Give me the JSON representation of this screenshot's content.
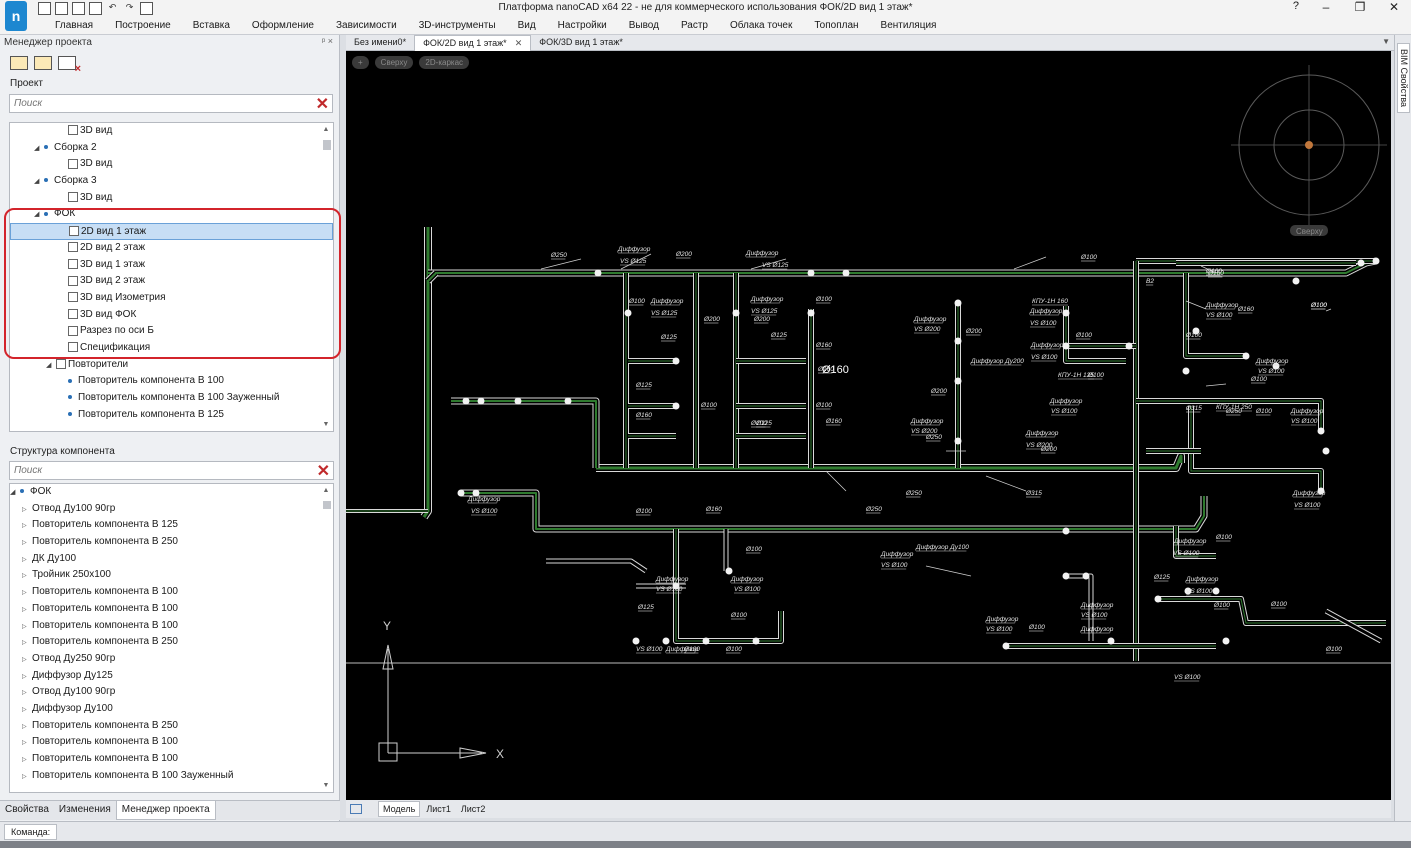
{
  "window": {
    "title": "Платформа nanoCAD x64 22 - не для коммерческого использования ФОК/2D вид 1 этаж*",
    "logo": "n",
    "controls": [
      "–",
      "❐",
      "✕"
    ],
    "help": "?"
  },
  "menu": [
    "Главная",
    "Построение",
    "Вставка",
    "Оформление",
    "Зависимости",
    "3D-инструменты",
    "Вид",
    "Настройки",
    "Вывод",
    "Растр",
    "Облака точек",
    "Топоплан",
    "Вентиляция"
  ],
  "left_panel": {
    "header": "Менеджер проекта",
    "project_label": "Проект",
    "search_placeholder": "Поиск",
    "project_tree": [
      {
        "label": "3D вид",
        "indent": 4,
        "icon": "view"
      },
      {
        "label": "Сборка 2",
        "indent": 2,
        "icon": "node"
      },
      {
        "label": "3D вид",
        "indent": 4,
        "icon": "view"
      },
      {
        "label": "Сборка 3",
        "indent": 2,
        "icon": "node"
      },
      {
        "label": "3D вид",
        "indent": 4,
        "icon": "view"
      },
      {
        "label": "ФОК",
        "indent": 2,
        "icon": "node"
      },
      {
        "label": "2D вид 1 этаж",
        "indent": 4,
        "icon": "view",
        "selected": true
      },
      {
        "label": "2D вид 2 этаж",
        "indent": 4,
        "icon": "view"
      },
      {
        "label": "3D вид 1 этаж",
        "indent": 4,
        "icon": "view"
      },
      {
        "label": "3D вид 2 этаж",
        "indent": 4,
        "icon": "view"
      },
      {
        "label": "3D вид Изометрия",
        "indent": 4,
        "icon": "view"
      },
      {
        "label": "3D вид ФОК",
        "indent": 4,
        "icon": "view"
      },
      {
        "label": "Разрез по оси Б",
        "indent": 4,
        "icon": "view"
      },
      {
        "label": "Спецификация",
        "indent": 4,
        "icon": "table"
      },
      {
        "label": "Повторители",
        "indent": 3,
        "icon": "folder"
      },
      {
        "label": "Повторитель компонента В 100",
        "indent": 4,
        "icon": "dot"
      },
      {
        "label": "Повторитель компонента В 100 Зауженный",
        "indent": 4,
        "icon": "dot"
      },
      {
        "label": "Повторитель компонента В 125",
        "indent": 4,
        "icon": "dot"
      }
    ],
    "structure_label": "Структура компонента",
    "structure_search_placeholder": "Поиск",
    "structure_root": "ФОК",
    "structure_items": [
      "Отвод Ду100 90гр",
      "Повторитель компонента В 125",
      "Повторитель компонента В 250",
      "ДК Ду100",
      "Тройник 250х100",
      "Повторитель компонента В 100",
      "Повторитель компонента В 100",
      "Повторитель компонента В 100",
      "Повторитель компонента В 250",
      "Отвод Ду250 90гр",
      "Диффузор Ду125",
      "Отвод Ду100 90гр",
      "Диффузор Ду100",
      "Повторитель компонента В 250",
      "Повторитель компонента В 100",
      "Повторитель компонента В 100",
      "Повторитель компонента В 100 Зауженный"
    ],
    "bottom_tabs": [
      "Свойства",
      "Изменения",
      "Менеджер проекта"
    ]
  },
  "doc_tabs": [
    "Без имени0*",
    "ФОК/2D вид 1 этаж*",
    "ФОК/3D вид 1 этаж*"
  ],
  "view_controls": [
    "+",
    "Сверху",
    "2D-каркас"
  ],
  "viewcube_label": "Сверху",
  "model_tabs": [
    "Модель",
    "Лист1",
    "Лист2"
  ],
  "right_strip": "BIM Свойства",
  "command_label": "Команда:",
  "drawing_labels": [
    "Ø250",
    "Диффузор",
    "VS Ø125",
    "Ø200",
    "Диффузор",
    "VS Ø125",
    "Ø100",
    "Ø160",
    "Ø100",
    "Ø100",
    "Диффузор",
    "VS Ø125",
    "Ø200",
    "Ø125",
    "Ø125",
    "Ø160",
    "Ø100",
    "Ø100",
    "Диффузор",
    "VS Ø125",
    "Ø200",
    "Ø125",
    "Ø100",
    "Ø160",
    "Ø160",
    "Ø160",
    "Ø100",
    "Ø125",
    "Диффузор",
    "VS Ø200",
    "Ø200",
    "Диффузор Ду200",
    "Ø200",
    "Диффузор",
    "VS Ø200",
    "Ø250",
    "Диффузор",
    "VS Ø200",
    "Ø200",
    "КПУ-1Н 160",
    "Диффузор",
    "VS Ø100",
    "Ø100",
    "Диффузор",
    "VS Ø100",
    "КПУ-1Н 125",
    "Ø100",
    "Диффузор",
    "VS Ø100",
    "В2",
    "Ø160",
    "Диффузор",
    "VS Ø100",
    "Ø160",
    "Ø100",
    "Ø100",
    "Диффузор",
    "VS Ø100",
    "Ø100",
    "КПУ-1Н 250",
    "Ø315",
    "Ø250",
    "Ø100",
    "Диффузор",
    "VS Ø100",
    "Диффузор",
    "VS Ø100",
    "Ø315",
    "Диффузор",
    "VS Ø100",
    "Ø100",
    "Ø160",
    "Ø250",
    "Ø250",
    "Диффузор",
    "VS Ø100",
    "Диффузор Ду100",
    "Ø100",
    "Диффузор",
    "VS Ø100",
    "Диффузор",
    "VS Ø100",
    "Ø125",
    "Ø100",
    "Диффузор",
    "VS Ø100",
    "Диффузор",
    "VS Ø100",
    "Диффузор",
    "VS Ø100",
    "Ø100",
    "Ø125",
    "Ø100",
    "Диффузор",
    "VS Ø100",
    "Ø100",
    "Ø100",
    "Диффузор",
    "VS Ø100",
    "Ø100",
    "Диффузор",
    "VS Ø100",
    "Ø100",
    "Ø100"
  ],
  "ucs": {
    "x_label": "X",
    "y_label": "Y"
  },
  "colors": {
    "canvas_bg": "#000000",
    "duct_outline": "#d9d9d9",
    "duct_fill": "#2f7a2f",
    "accent_blue": "#1d87d0",
    "highlight_red": "#d3242b"
  }
}
